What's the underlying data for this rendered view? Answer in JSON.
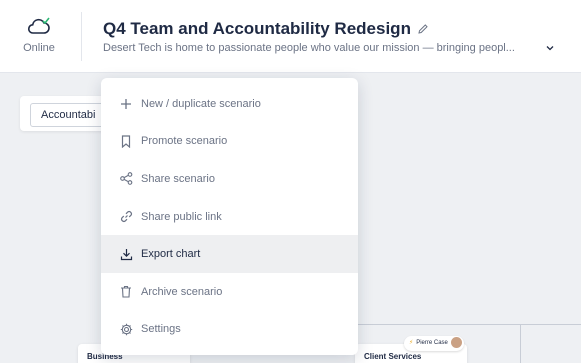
{
  "header": {
    "status_label": "Online",
    "title": "Q4 Team and Accountability Redesign",
    "description": "Desert Tech is home to passionate people who value our mission — bringing peopl..."
  },
  "toolbar": {
    "button_label": "Accountabi"
  },
  "menu": {
    "items": [
      {
        "label": "New / duplicate scenario",
        "icon": "plus-icon"
      },
      {
        "label": "Promote scenario",
        "icon": "bookmark-icon"
      },
      {
        "label": "Share scenario",
        "icon": "share-icon"
      },
      {
        "label": "Share public link",
        "icon": "link-icon"
      },
      {
        "label": "Export chart",
        "icon": "download-icon",
        "highlighted": true
      },
      {
        "label": "Archive scenario",
        "icon": "trash-icon"
      },
      {
        "label": "Settings",
        "icon": "gear-icon"
      }
    ]
  },
  "chart_nodes": {
    "business": "Business",
    "client_services": "Client Services",
    "person_name": "Pierre Case"
  },
  "colors": {
    "status_green": "#2bb673",
    "menu_highlight": "#eeeff1",
    "title_color": "#1f2a44"
  }
}
